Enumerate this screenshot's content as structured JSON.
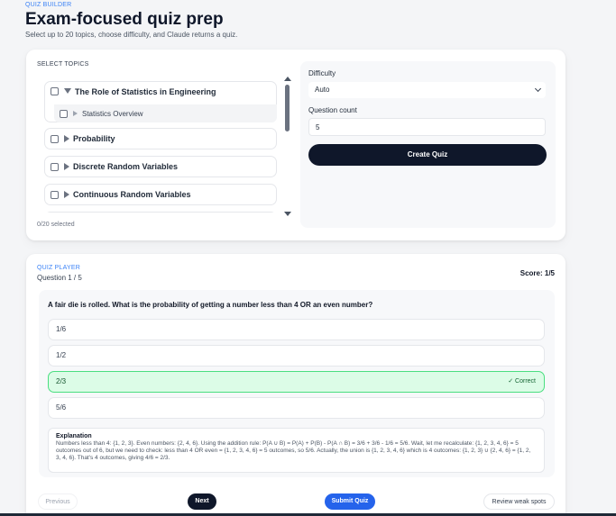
{
  "header": {
    "eyebrow": "QUIZ BUILDER",
    "title": "Exam-focused quiz prep",
    "subtitle": "Select up to 20 topics, choose difficulty, and Claude returns a quiz."
  },
  "builder": {
    "section_label": "SELECT TOPICS",
    "topics": [
      {
        "label": "The Role of Statistics in Engineering",
        "expanded": true,
        "checked": false,
        "subtopics": [
          {
            "label": "Statistics Overview",
            "checked": false
          }
        ]
      },
      {
        "label": "Probability",
        "expanded": false,
        "checked": false
      },
      {
        "label": "Discrete Random Variables",
        "expanded": false,
        "checked": false
      },
      {
        "label": "Continuous Random Variables",
        "expanded": false,
        "checked": false
      }
    ],
    "selected_count": "0/20 selected",
    "difficulty_label": "Difficulty",
    "difficulty_value": "Auto",
    "question_count_label": "Question count",
    "question_count_value": "5",
    "create_button": "Create Quiz"
  },
  "player": {
    "eyebrow": "QUIZ PLAYER",
    "question_number": "Question 1 / 5",
    "score": "Score: 1/5",
    "question": "A fair die is rolled. What is the probability of getting a number less than 4 OR an even number?",
    "options": [
      {
        "label": "1/6",
        "state": "normal"
      },
      {
        "label": "1/2",
        "state": "normal"
      },
      {
        "label": "2/3",
        "state": "correct"
      },
      {
        "label": "5/6",
        "state": "normal"
      }
    ],
    "correct_tag": "✓ Correct",
    "explanation_title": "Explanation",
    "explanation_body": "Numbers less than 4: {1, 2, 3}. Even numbers: {2, 4, 6}. Using the addition rule: P(A ∪ B) = P(A) + P(B) - P(A ∩ B) = 3/6 + 3/6 - 1/6 = 5/6. Wait, let me recalculate: {1, 2, 3, 4, 6} = 5 outcomes out of 6, but we need to check: less than 4 OR even = {1, 2, 3, 4, 6} = 5 outcomes, so 5/6. Actually, the union is {1, 2, 3, 4, 6} which is 4 outcomes: {1, 2, 3} ∪ {2, 4, 6} = {1, 2, 3, 4, 6}. That's 4 outcomes, giving 4/6 = 2/3.",
    "buttons": {
      "previous": "Previous",
      "next": "Next",
      "submit": "Submit Quiz",
      "weak_spots": "Review weak spots"
    }
  },
  "colors": {
    "accent": "#3b82f6",
    "primary_dark": "#0f172a",
    "submit_blue": "#2563eb",
    "correct_bg": "#dcfce7",
    "correct_border": "#4ade80"
  }
}
